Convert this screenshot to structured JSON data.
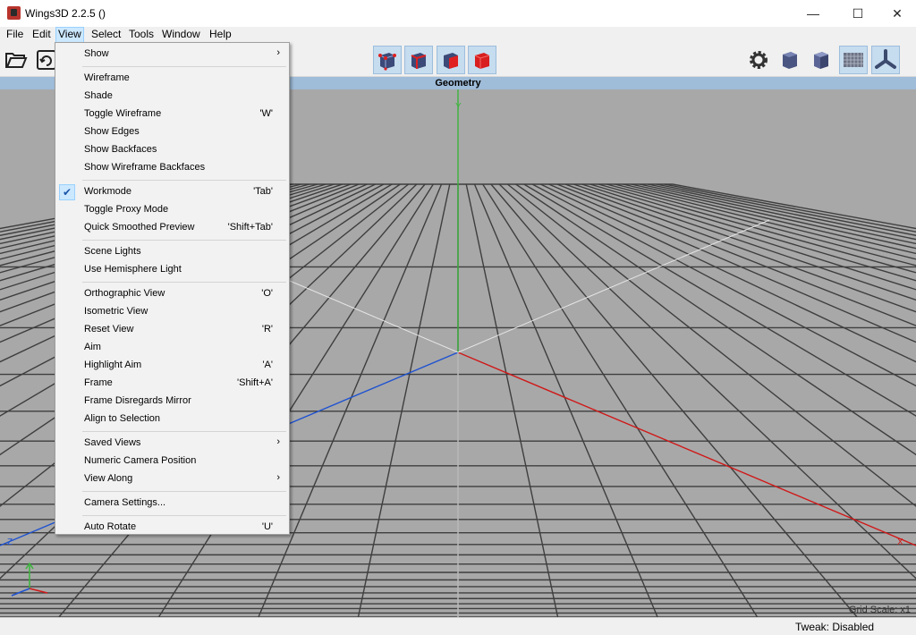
{
  "window": {
    "title": "Wings3D 2.2.5 ()",
    "minimize_glyph": "—",
    "maximize_glyph": "☐",
    "close_glyph": "✕"
  },
  "menubar": [
    "File",
    "Edit",
    "View",
    "Select",
    "Tools",
    "Window",
    "Help"
  ],
  "toolbar": {
    "left_icons": [
      "open-folder-icon",
      "save-icon"
    ],
    "center_icons": [
      "vertex-select-icon",
      "edge-select-icon",
      "face-select-icon",
      "body-select-icon"
    ],
    "right_icons": [
      "settings-gear-icon",
      "smooth-shading-icon",
      "flat-shading-icon",
      "ground-plane-icon",
      "axes-icon"
    ]
  },
  "viewport": {
    "header": "Geometry",
    "grid_scale": "Grid Scale: x1",
    "axis_y": "Y",
    "axis_x": "X",
    "axis_z": "Z"
  },
  "status": {
    "text": "Tweak: Disabled"
  },
  "view_menu": {
    "groups": [
      [
        {
          "label": "Show",
          "submenu": true
        }
      ],
      [
        {
          "label": "Wireframe"
        },
        {
          "label": "Shade"
        },
        {
          "label": "Toggle Wireframe",
          "shortcut": "'W'"
        },
        {
          "label": "Show Edges"
        },
        {
          "label": "Show Backfaces"
        },
        {
          "label": "Show Wireframe Backfaces"
        }
      ],
      [
        {
          "label": "Workmode",
          "shortcut": "'Tab'",
          "checked": true
        },
        {
          "label": "Toggle Proxy Mode"
        },
        {
          "label": "Quick Smoothed Preview",
          "shortcut": "'Shift+Tab'"
        }
      ],
      [
        {
          "label": "Scene Lights"
        },
        {
          "label": "Use Hemisphere Light"
        }
      ],
      [
        {
          "label": "Orthographic View",
          "shortcut": "'O'"
        },
        {
          "label": "Isometric View"
        },
        {
          "label": "Reset View",
          "shortcut": "'R'"
        },
        {
          "label": "Aim"
        },
        {
          "label": "Highlight Aim",
          "shortcut": "'A'"
        },
        {
          "label": "Frame",
          "shortcut": "'Shift+A'"
        },
        {
          "label": "Frame Disregards Mirror"
        },
        {
          "label": "Align to Selection"
        }
      ],
      [
        {
          "label": "Saved Views",
          "submenu": true
        },
        {
          "label": "Numeric Camera Position"
        },
        {
          "label": "View Along",
          "submenu": true
        }
      ],
      [
        {
          "label": "Camera Settings..."
        }
      ],
      [
        {
          "label": "Auto Rotate",
          "shortcut": "'U'"
        }
      ]
    ],
    "check_glyph": "✔",
    "submenu_glyph": "›"
  }
}
